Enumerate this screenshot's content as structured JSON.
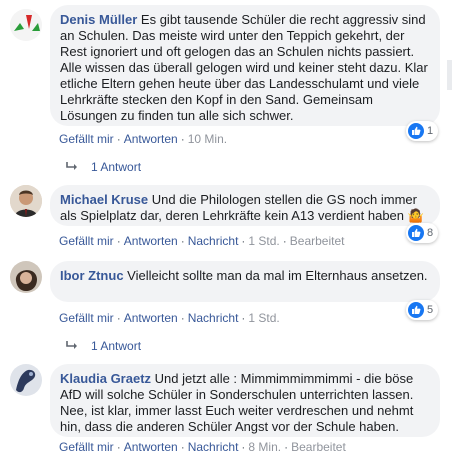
{
  "comments": [
    {
      "author": "Denis Müller",
      "text": "Es gibt tausende Schüler die recht aggressiv sind an Schulen. Das meiste wird unter den Teppich gekehrt, der Rest ignoriert und oft gelogen das an Schulen nichts passiert. Alle wissen das überall gelogen wird und keiner steht dazu. Klar etliche Eltern gehen heute über das Landesschulamt und viele Lehrkräfte stecken den Kopf in den Sand. Gemeinsam Lösungen zu finden tun alle sich schwer.",
      "like_label": "Gefällt mir",
      "reply_label": "Antworten",
      "time": "10 Min.",
      "reaction_count": "1",
      "replies_label": "1 Antwort"
    },
    {
      "author": "Michael Kruse",
      "text": "Und die Philologen stellen die GS noch immer als Spielplatz dar, deren Lehrkräfte kein A13 verdient haben",
      "emoji": "🤷",
      "like_label": "Gefällt mir",
      "reply_label": "Antworten",
      "message_label": "Nachricht",
      "time": "1 Std.",
      "edited_label": "Bearbeitet",
      "reaction_count": "8"
    },
    {
      "author": "Ibor Ztnuc",
      "text": "Vielleicht sollte man da mal im Elternhaus ansetzen.",
      "like_label": "Gefällt mir",
      "reply_label": "Antworten",
      "message_label": "Nachricht",
      "time": "1 Std.",
      "reaction_count": "5",
      "replies_label": "1 Antwort"
    },
    {
      "author": "Klaudia Graetz",
      "text": "Und jetzt alle : Mimmimmimmimmi - die böse AfD will solche Schüler in Sonderschulen unterrichten lassen. Nee, ist klar, immer lasst Euch weiter verdreschen und nehmt hin, dass die anderen Schüler Angst vor der Schule haben.",
      "like_label": "Gefällt mir",
      "reply_label": "Antworten",
      "message_label": "Nachricht",
      "time": "8 Min.",
      "edited_label": "Bearbeitet"
    }
  ],
  "colors": {
    "author": "#385898",
    "bubble": "#f2f3f5",
    "like_blue": "#1877f2"
  }
}
